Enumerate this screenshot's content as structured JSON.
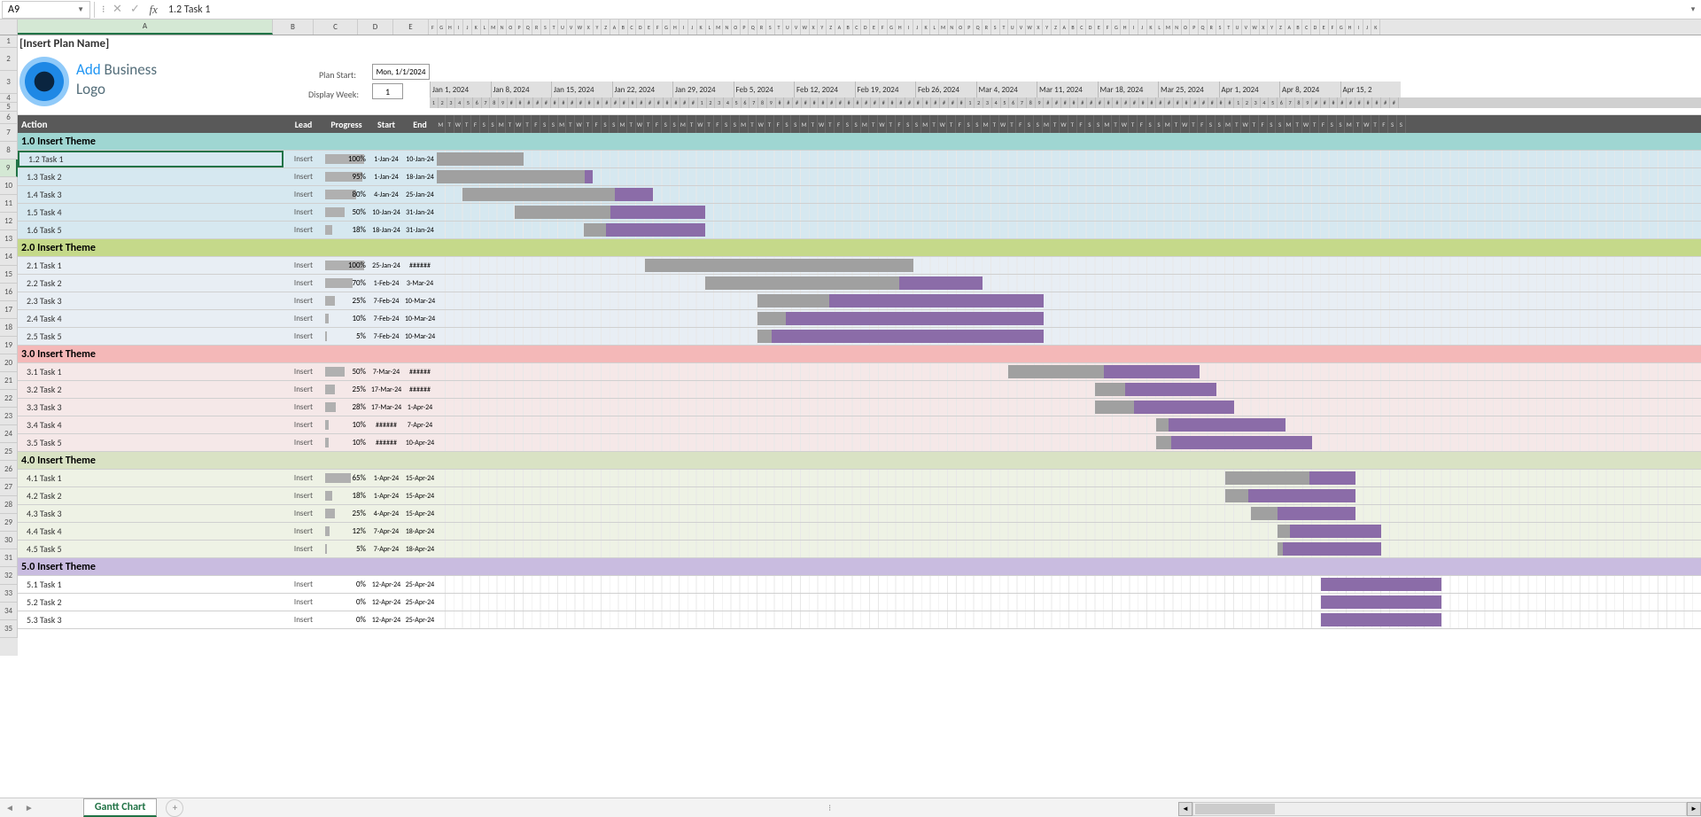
{
  "namebox": "A9",
  "formula": "1.2 Task 1",
  "title": "[Insert Plan Name]",
  "logo": {
    "line1a": "Add ",
    "line1b": "Business",
    "line2": "Logo"
  },
  "plan_start_label": "Plan Start:",
  "plan_start_value": "Mon, 1/1/2024",
  "display_week_label": "Display Week:",
  "display_week_value": "1",
  "headers": {
    "action": "Action",
    "lead": "Lead",
    "progress": "Progress",
    "start": "Start",
    "end": "End"
  },
  "weeks": [
    "Jan 1, 2024",
    "Jan 8, 2024",
    "Jan 15, 2024",
    "Jan 22, 2024",
    "Jan 29, 2024",
    "Feb 5, 2024",
    "Feb 12, 2024",
    "Feb 19, 2024",
    "Feb 26, 2024",
    "Mar 4, 2024",
    "Mar 11, 2024",
    "Mar 18, 2024",
    "Mar 25, 2024",
    "Apr 1, 2024",
    "Apr 8, 2024",
    "Apr 15, 2"
  ],
  "day_letters": [
    "M",
    "T",
    "W",
    "T",
    "F",
    "S",
    "S"
  ],
  "col_letters_left": [
    "A",
    "B",
    "C",
    "D",
    "E"
  ],
  "col_letters_narrow": [
    "F",
    "G",
    "H",
    "I",
    "J",
    "K",
    "L",
    "M",
    "N",
    "O",
    "P",
    "Q",
    "R",
    "S",
    "T",
    "U",
    "V",
    "W",
    "X",
    "Y",
    "Z",
    "AA",
    "AB",
    "AC",
    "AD",
    "AE",
    "AF",
    "AG",
    "AH",
    "AI",
    "AJ",
    "AK",
    "AL",
    "AM",
    "AN",
    "AO",
    "AP",
    "AQ",
    "AR",
    "AS",
    "AT",
    "AU",
    "AV",
    "AW",
    "AX",
    "AY",
    "AZ",
    "BA",
    "BB",
    "BC",
    "BD",
    "BE",
    "BF",
    "BG",
    "BH",
    "BI",
    "BJ",
    "BK",
    "BL",
    "BM",
    "BN",
    "BO",
    "BP",
    "BQ",
    "BR",
    "BS",
    "BT",
    "BU",
    "BV",
    "BW",
    "BX",
    "BY",
    "BZ",
    "CA",
    "CB",
    "CC",
    "CD",
    "CE",
    "CF",
    "CG",
    "CH",
    "CI",
    "CJ",
    "CK",
    "CL",
    "CM",
    "CN",
    "CO",
    "CP",
    "CQ",
    "CR",
    "CS",
    "CT",
    "CU",
    "CV",
    "CW",
    "CX",
    "CY",
    "CZ",
    "DA",
    "DB",
    "DC",
    "DD",
    "DE",
    "DF",
    "DG",
    "DH",
    "DI",
    "DJ",
    "DK"
  ],
  "row_nums": [
    "1",
    "2",
    "3",
    "4",
    "5",
    "6",
    "7",
    "8",
    "9",
    "10",
    "11",
    "12",
    "13",
    "14",
    "15",
    "16",
    "17",
    "18",
    "19",
    "20",
    "21",
    "22",
    "23",
    "24",
    "25",
    "26",
    "27",
    "28",
    "29",
    "30",
    "31",
    "32",
    "33",
    "34",
    "35"
  ],
  "themes": [
    {
      "label": "1.0 Insert Theme",
      "cls": "theme-1",
      "row_bg": "row-bg-1",
      "tasks": [
        {
          "name": "1.2 Task 1",
          "lead": "Insert",
          "prog": "100%",
          "pbar": 100,
          "start": "1-Jan-24",
          "end": "10-Jan-24",
          "g_start": 0,
          "g_len": 10,
          "g_comp": 0,
          "sel": true
        },
        {
          "name": "1.3 Task 2",
          "lead": "Insert",
          "prog": "95%",
          "pbar": 95,
          "start": "1-Jan-24",
          "end": "18-Jan-24",
          "g_start": 0,
          "g_len": 18,
          "g_comp": 5
        },
        {
          "name": "1.4 Task 3",
          "lead": "Insert",
          "prog": "80%",
          "pbar": 80,
          "start": "4-Jan-24",
          "end": "25-Jan-24",
          "g_start": 3,
          "g_len": 22,
          "g_comp": 20
        },
        {
          "name": "1.5 Task 4",
          "lead": "Insert",
          "prog": "50%",
          "pbar": 50,
          "start": "10-Jan-24",
          "end": "31-Jan-24",
          "g_start": 9,
          "g_len": 22,
          "g_comp": 50
        },
        {
          "name": "1.6 Task 5",
          "lead": "Insert",
          "prog": "18%",
          "pbar": 18,
          "start": "18-Jan-24",
          "end": "31-Jan-24",
          "g_start": 17,
          "g_len": 14,
          "g_comp": 82
        }
      ]
    },
    {
      "label": "2.0 Insert Theme",
      "cls": "theme-2",
      "row_bg": "row-bg-2",
      "tasks": [
        {
          "name": "2.1 Task 1",
          "lead": "Insert",
          "prog": "100%",
          "pbar": 100,
          "start": "25-Jan-24",
          "end": "######",
          "g_start": 24,
          "g_len": 31,
          "g_comp": 0
        },
        {
          "name": "2.2 Task 2",
          "lead": "Insert",
          "prog": "70%",
          "pbar": 70,
          "start": "1-Feb-24",
          "end": "3-Mar-24",
          "g_start": 31,
          "g_len": 32,
          "g_comp": 30
        },
        {
          "name": "2.3 Task 3",
          "lead": "Insert",
          "prog": "25%",
          "pbar": 25,
          "start": "7-Feb-24",
          "end": "10-Mar-24",
          "g_start": 37,
          "g_len": 33,
          "g_comp": 75
        },
        {
          "name": "2.4 Task 4",
          "lead": "Insert",
          "prog": "10%",
          "pbar": 10,
          "start": "7-Feb-24",
          "end": "10-Mar-24",
          "g_start": 37,
          "g_len": 33,
          "g_comp": 90
        },
        {
          "name": "2.5 Task 5",
          "lead": "Insert",
          "prog": "5%",
          "pbar": 5,
          "start": "7-Feb-24",
          "end": "10-Mar-24",
          "g_start": 37,
          "g_len": 33,
          "g_comp": 95
        }
      ]
    },
    {
      "label": "3.0 Insert Theme",
      "cls": "theme-3",
      "row_bg": "row-bg-3",
      "tasks": [
        {
          "name": "3.1 Task 1",
          "lead": "Insert",
          "prog": "50%",
          "pbar": 50,
          "start": "7-Mar-24",
          "end": "######",
          "g_start": 66,
          "g_len": 22,
          "g_comp": 50
        },
        {
          "name": "3.2 Task 2",
          "lead": "Insert",
          "prog": "25%",
          "pbar": 25,
          "start": "17-Mar-24",
          "end": "######",
          "g_start": 76,
          "g_len": 14,
          "g_comp": 75
        },
        {
          "name": "3.3 Task 3",
          "lead": "Insert",
          "prog": "28%",
          "pbar": 28,
          "start": "17-Mar-24",
          "end": "1-Apr-24",
          "g_start": 76,
          "g_len": 16,
          "g_comp": 72
        },
        {
          "name": "3.4 Task 4",
          "lead": "Insert",
          "prog": "10%",
          "pbar": 10,
          "start": "######",
          "end": "7-Apr-24",
          "g_start": 83,
          "g_len": 15,
          "g_comp": 90
        },
        {
          "name": "3.5 Task 5",
          "lead": "Insert",
          "prog": "10%",
          "pbar": 10,
          "start": "######",
          "end": "10-Apr-24",
          "g_start": 83,
          "g_len": 18,
          "g_comp": 90
        }
      ]
    },
    {
      "label": "4.0 Insert Theme",
      "cls": "theme-4",
      "row_bg": "row-bg-4",
      "tasks": [
        {
          "name": "4.1 Task 1",
          "lead": "Insert",
          "prog": "65%",
          "pbar": 65,
          "start": "1-Apr-24",
          "end": "15-Apr-24",
          "g_start": 91,
          "g_len": 15,
          "g_comp": 35
        },
        {
          "name": "4.2 Task 2",
          "lead": "Insert",
          "prog": "18%",
          "pbar": 18,
          "start": "1-Apr-24",
          "end": "15-Apr-24",
          "g_start": 91,
          "g_len": 15,
          "g_comp": 82
        },
        {
          "name": "4.3 Task 3",
          "lead": "Insert",
          "prog": "25%",
          "pbar": 25,
          "start": "4-Apr-24",
          "end": "15-Apr-24",
          "g_start": 94,
          "g_len": 12,
          "g_comp": 75
        },
        {
          "name": "4.4 Task 4",
          "lead": "Insert",
          "prog": "12%",
          "pbar": 12,
          "start": "7-Apr-24",
          "end": "18-Apr-24",
          "g_start": 97,
          "g_len": 12,
          "g_comp": 88
        },
        {
          "name": "4.5 Task 5",
          "lead": "Insert",
          "prog": "5%",
          "pbar": 5,
          "start": "7-Apr-24",
          "end": "18-Apr-24",
          "g_start": 97,
          "g_len": 12,
          "g_comp": 95
        }
      ]
    },
    {
      "label": "5.0 Insert Theme",
      "cls": "theme-5",
      "row_bg": "",
      "tasks": [
        {
          "name": "5.1 Task 1",
          "lead": "Insert",
          "prog": "0%",
          "pbar": 0,
          "start": "12-Apr-24",
          "end": "25-Apr-24",
          "g_start": 102,
          "g_len": 14,
          "g_comp": 100
        },
        {
          "name": "5.2 Task 2",
          "lead": "Insert",
          "prog": "0%",
          "pbar": 0,
          "start": "12-Apr-24",
          "end": "25-Apr-24",
          "g_start": 102,
          "g_len": 14,
          "g_comp": 100
        },
        {
          "name": "5.3 Task 3",
          "lead": "Insert",
          "prog": "0%",
          "pbar": 0,
          "start": "12-Apr-24",
          "end": "25-Apr-24",
          "g_start": 102,
          "g_len": 14,
          "g_comp": 100
        }
      ]
    }
  ],
  "sheet_tab": "Gantt Chart"
}
